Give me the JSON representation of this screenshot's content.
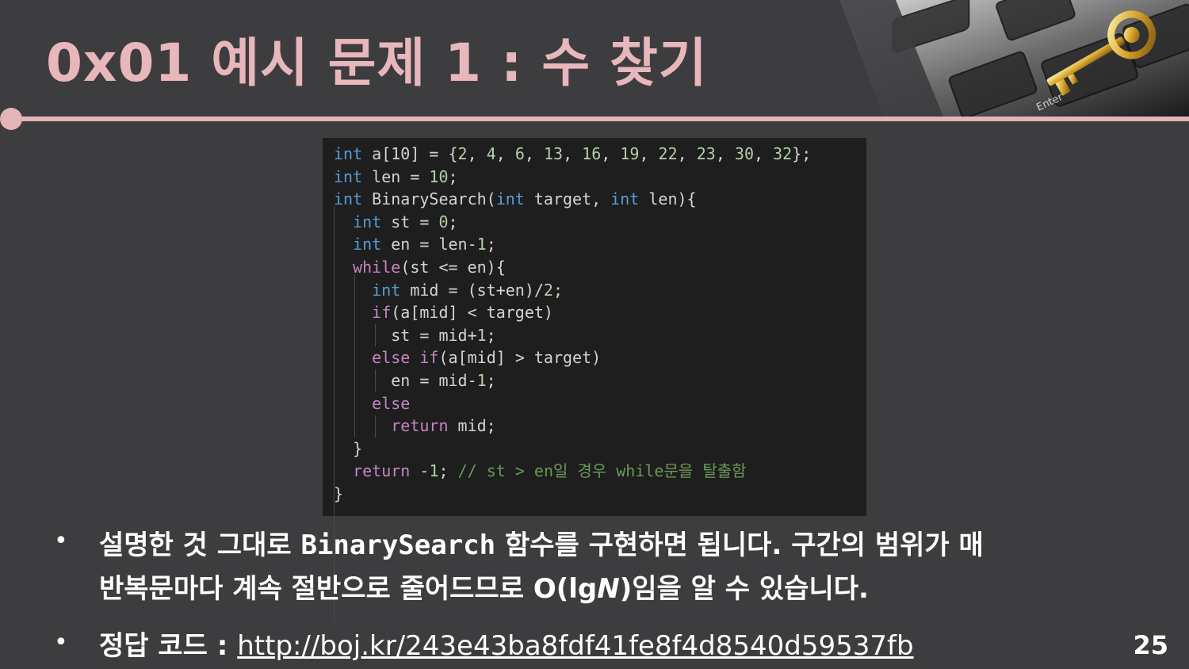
{
  "slide": {
    "title": "0x01  예시 문제 1 : 수 찾기",
    "page_number": "25"
  },
  "code": {
    "lines": [
      [
        {
          "t": "int",
          "c": "kw"
        },
        {
          "t": " a[10] = {"
        },
        {
          "t": "2",
          "c": "num"
        },
        {
          "t": ", "
        },
        {
          "t": "4",
          "c": "num"
        },
        {
          "t": ", "
        },
        {
          "t": "6",
          "c": "num"
        },
        {
          "t": ", "
        },
        {
          "t": "13",
          "c": "num"
        },
        {
          "t": ", "
        },
        {
          "t": "16",
          "c": "num"
        },
        {
          "t": ", "
        },
        {
          "t": "19",
          "c": "num"
        },
        {
          "t": ", "
        },
        {
          "t": "22",
          "c": "num"
        },
        {
          "t": ", "
        },
        {
          "t": "23",
          "c": "num"
        },
        {
          "t": ", "
        },
        {
          "t": "30",
          "c": "num"
        },
        {
          "t": ", "
        },
        {
          "t": "32",
          "c": "num"
        },
        {
          "t": "};"
        }
      ],
      [
        {
          "t": "int",
          "c": "kw"
        },
        {
          "t": " len = "
        },
        {
          "t": "10",
          "c": "num"
        },
        {
          "t": ";"
        }
      ],
      [
        {
          "t": "int",
          "c": "kw"
        },
        {
          "t": " BinarySearch("
        },
        {
          "t": "int",
          "c": "kw"
        },
        {
          "t": " target, "
        },
        {
          "t": "int",
          "c": "kw"
        },
        {
          "t": " len){"
        }
      ],
      [
        {
          "t": "  "
        },
        {
          "t": "int",
          "c": "kw"
        },
        {
          "t": " st = "
        },
        {
          "t": "0",
          "c": "num"
        },
        {
          "t": ";"
        }
      ],
      [
        {
          "t": "  "
        },
        {
          "t": "int",
          "c": "kw"
        },
        {
          "t": " en = len-"
        },
        {
          "t": "1",
          "c": "num"
        },
        {
          "t": ";"
        }
      ],
      [
        {
          "t": "  "
        },
        {
          "t": "while",
          "c": "ctl"
        },
        {
          "t": "(st <= en){"
        }
      ],
      [
        {
          "t": "    "
        },
        {
          "t": "int",
          "c": "kw"
        },
        {
          "t": " mid = (st+en)/"
        },
        {
          "t": "2",
          "c": "num"
        },
        {
          "t": ";"
        }
      ],
      [
        {
          "t": "    "
        },
        {
          "t": "if",
          "c": "ctl"
        },
        {
          "t": "(a[mid] < target)"
        }
      ],
      [
        {
          "t": "      st = mid+"
        },
        {
          "t": "1",
          "c": "num"
        },
        {
          "t": ";"
        }
      ],
      [
        {
          "t": "    "
        },
        {
          "t": "else",
          "c": "ctl"
        },
        {
          "t": " "
        },
        {
          "t": "if",
          "c": "ctl"
        },
        {
          "t": "(a[mid] > target)"
        }
      ],
      [
        {
          "t": "      en = mid-"
        },
        {
          "t": "1",
          "c": "num"
        },
        {
          "t": ";"
        }
      ],
      [
        {
          "t": "    "
        },
        {
          "t": "else",
          "c": "ctl"
        }
      ],
      [
        {
          "t": "      "
        },
        {
          "t": "return",
          "c": "ctl"
        },
        {
          "t": " mid;"
        }
      ],
      [
        {
          "t": "  }"
        }
      ],
      [
        {
          "t": "  "
        },
        {
          "t": "return",
          "c": "ctl"
        },
        {
          "t": " -"
        },
        {
          "t": "1",
          "c": "num"
        },
        {
          "t": "; "
        },
        {
          "t": "// st > en일 경우 while문을 탈출함",
          "c": "cm"
        }
      ],
      [
        {
          "t": "}"
        }
      ]
    ]
  },
  "bullets": {
    "b1_prefix": "설명한 것 그대로 ",
    "b1_code": "BinarySearch",
    "b1_suffix": " 함수를 구현하면 됩니다. 구간의 범위가 매",
    "b1_line2_prefix": "반복문마다 계속 절반으로 줄어드므로 O(lg",
    "b1_line2_n": "N",
    "b1_line2_suffix": ")임을 알 수 있습니다.",
    "b2_prefix": "정답 코드 : ",
    "b2_link": "http://boj.kr/243e43ba8fdf41fe8f4d8540d59537fb",
    "bullet_char": "•"
  },
  "image": {
    "icon": "keyboard-key-image"
  }
}
